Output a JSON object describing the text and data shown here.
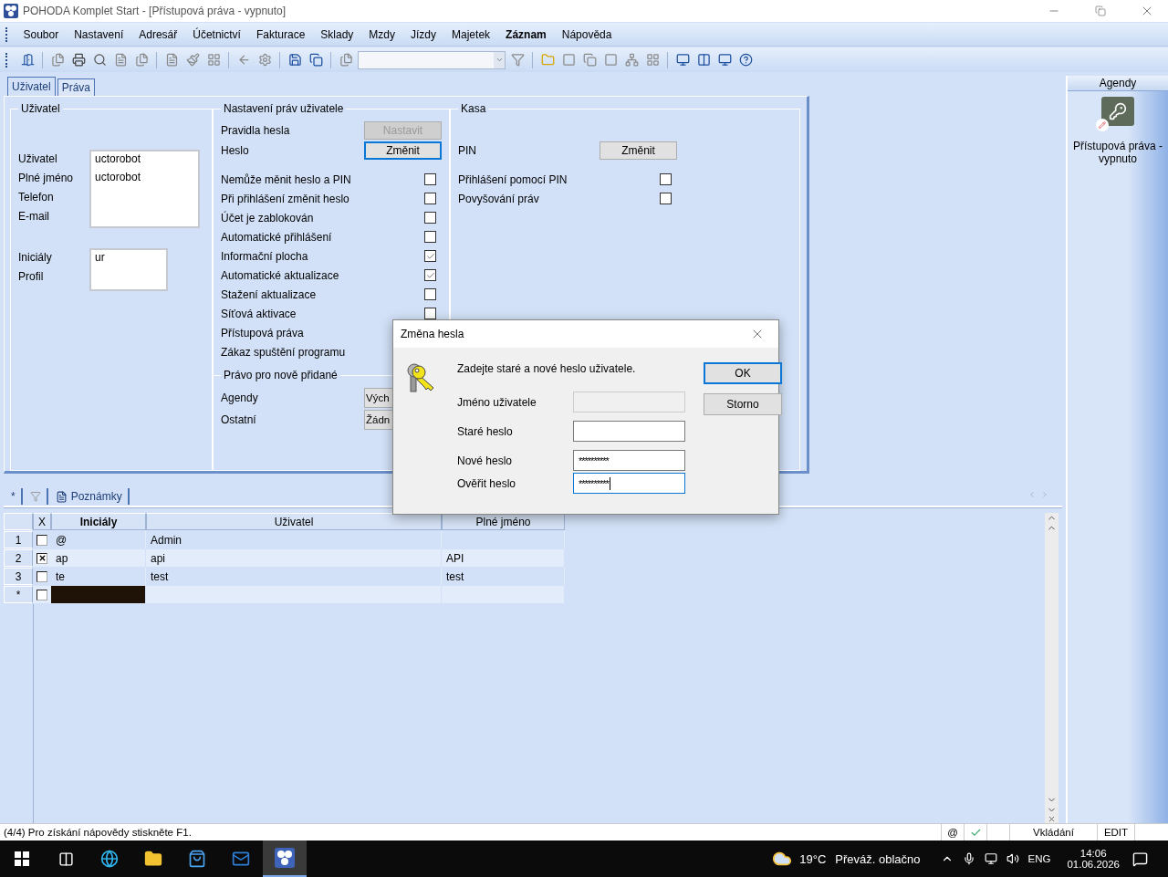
{
  "window": {
    "title": "POHODA Komplet Start - [Přístupová práva - vypnuto]"
  },
  "menu": [
    {
      "label": "Soubor",
      "bold": false
    },
    {
      "label": "Nastavení",
      "bold": false
    },
    {
      "label": "Adresář",
      "bold": false
    },
    {
      "label": "Účetnictví",
      "bold": false
    },
    {
      "label": "Fakturace",
      "bold": false
    },
    {
      "label": "Sklady",
      "bold": false
    },
    {
      "label": "Mzdy",
      "bold": false
    },
    {
      "label": "Jízdy",
      "bold": false
    },
    {
      "label": "Majetek",
      "bold": false
    },
    {
      "label": "Záznam",
      "bold": true
    },
    {
      "label": "Nápověda",
      "bold": false
    }
  ],
  "tabs": [
    {
      "label": "Uživatel",
      "selected": true
    },
    {
      "label": "Práva",
      "selected": false
    }
  ],
  "user_section": {
    "title": "Uživatel",
    "groups": [
      {
        "fields": [
          {
            "label": "Uživatel",
            "value": "uctorobot"
          },
          {
            "label": "Plné jméno",
            "value": "uctorobot"
          },
          {
            "label": "Telefon"
          },
          {
            "label": "E-mail"
          }
        ]
      },
      {
        "fields": [
          {
            "label": "Iniciály",
            "value": "ur"
          },
          {
            "label": "Profil"
          }
        ]
      }
    ]
  },
  "rights_section": {
    "title": "Nastavení práv uživatele",
    "items": [
      {
        "kind": "button",
        "label": "Pravidla hesla",
        "button": "Nastavit",
        "disabled": true,
        "focused": false
      },
      {
        "kind": "button",
        "label": "Heslo",
        "button": "Změnit",
        "disabled": false,
        "focused": true
      },
      {
        "kind": "checkbox",
        "label": "Nemůže měnit heslo a PIN",
        "checked": false
      },
      {
        "kind": "checkbox",
        "label": "Při přihlášení změnit heslo",
        "checked": false
      },
      {
        "kind": "checkbox",
        "label": "Účet je zablokován",
        "checked": false
      },
      {
        "kind": "checkbox",
        "label": "Automatické přihlášení",
        "checked": false
      },
      {
        "kind": "checkbox",
        "label": "Informační plocha",
        "checked": true
      },
      {
        "kind": "checkbox",
        "label": "Automatické aktualizace",
        "checked": true
      },
      {
        "kind": "checkbox",
        "label": "Stažení aktualizace",
        "checked": false
      },
      {
        "kind": "checkbox",
        "label": "Síťová aktivace",
        "checked": false
      },
      {
        "kind": "label",
        "label": "Přístupová práva"
      },
      {
        "kind": "label",
        "label": "Zákaz spuštění programu"
      }
    ],
    "subsection": {
      "title": "Právo pro nově přidané",
      "items": [
        {
          "label": "Agendy",
          "button": "Vých"
        },
        {
          "label": "Ostatní",
          "button": "Žádn"
        }
      ]
    }
  },
  "cash_section": {
    "title": "Kasa",
    "items": [
      {
        "kind": "button",
        "label": "PIN",
        "button": "Změnit",
        "disabled": false,
        "focused": false
      },
      {
        "kind": "checkbox",
        "label": "Přihlášení pomocí PIN",
        "checked": false
      },
      {
        "kind": "checkbox",
        "label": "Povyšování práv",
        "checked": false
      }
    ]
  },
  "lower_tabs": [
    {
      "kind": "star",
      "label": "*"
    },
    {
      "kind": "filter"
    },
    {
      "kind": "notes",
      "label": "Poznámky"
    }
  ],
  "table": {
    "columns": [
      "X",
      "Iniciály",
      "Uživatel",
      "Plné jméno"
    ],
    "rows": [
      {
        "number": "1",
        "checked": false,
        "initials": "@",
        "user": "Admin",
        "selected": false
      },
      {
        "number": "2",
        "checked": true,
        "initials": "ap",
        "user": "api",
        "full_name": "API",
        "selected": false
      },
      {
        "number": "3",
        "checked": false,
        "initials": "te",
        "user": "test",
        "full_name": "test",
        "selected": false
      },
      {
        "number": "*",
        "checked": false,
        "selected": true
      }
    ]
  },
  "sidebar": {
    "title": "Agendy",
    "item": "Přístupová práva - vypnuto"
  },
  "dialog": {
    "title": "Změna hesla",
    "prompt": "Zadejte staré a nové heslo uživatele.",
    "fields": [
      {
        "label": "Jméno uživatele",
        "disabled": true,
        "focused": false
      },
      {
        "label": "Staré heslo",
        "disabled": false,
        "focused": false
      },
      {
        "label": "Nové heslo",
        "value": "**********",
        "disabled": false,
        "focused": false
      },
      {
        "label": "Ověřit heslo",
        "value": "**********",
        "disabled": false,
        "focused": true
      }
    ],
    "buttons": [
      {
        "label": "OK",
        "focused": true
      },
      {
        "label": "Storno",
        "focused": false
      }
    ]
  },
  "status_bar": {
    "message": "(4/4) Pro získání nápovědy stiskněte F1.",
    "at": "@",
    "mode": "Vkládání",
    "state": "EDIT"
  },
  "taskbar": {
    "temperature": "19°C",
    "weather": "Převáž. oblačno",
    "language": "ENG",
    "time": "14:06",
    "date": "01.06.2026"
  }
}
